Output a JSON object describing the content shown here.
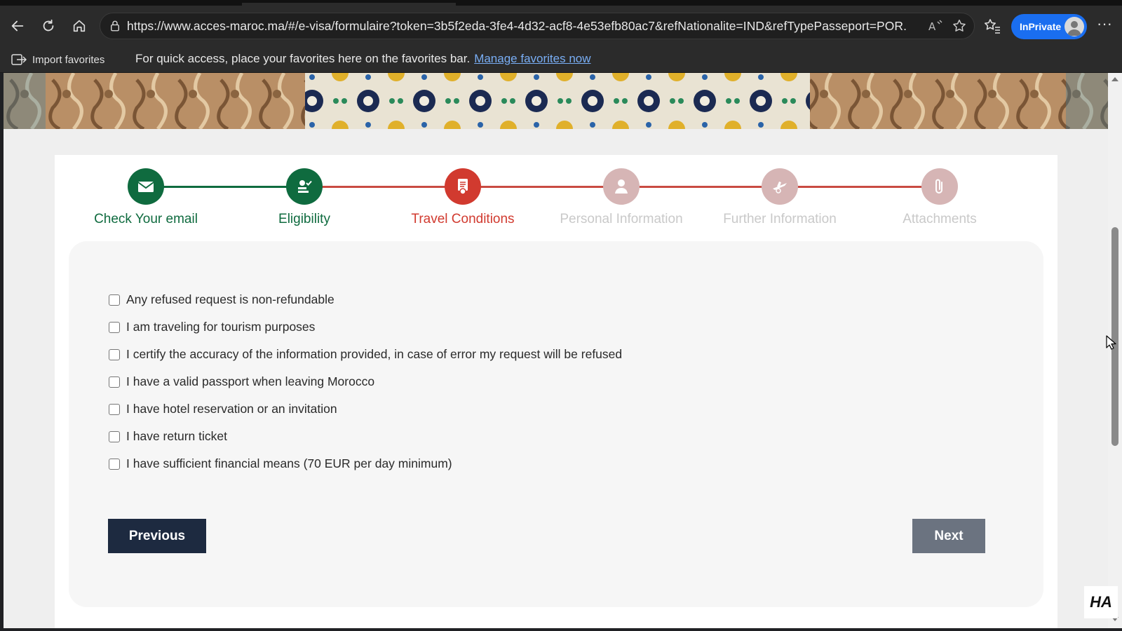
{
  "browser": {
    "url": "https://www.acces-maroc.ma/#/e-visa/formulaire?token=3b5f2eda-3fe4-4d32-acf8-4e53efb80ac7&refNationalite=IND&refTypePasseport=POR...",
    "profile_label": "InPrivate",
    "favorites_bar": {
      "import_label": "Import favorites",
      "message": "For quick access, place your favorites here on the favorites bar.",
      "manage_link": "Manage favorites now"
    }
  },
  "stepper": {
    "steps": [
      {
        "label": "Check Your email",
        "status": "done",
        "icon": "envelope-icon"
      },
      {
        "label": "Eligibility",
        "status": "done",
        "icon": "person-check-icon"
      },
      {
        "label": "Travel Conditions",
        "status": "active",
        "icon": "document-badge-icon"
      },
      {
        "label": "Personal Information",
        "status": "pending",
        "icon": "person-icon"
      },
      {
        "label": "Further Information",
        "status": "pending",
        "icon": "plane-icon"
      },
      {
        "label": "Attachments",
        "status": "pending",
        "icon": "paperclip-icon"
      }
    ],
    "colors": {
      "done": "#0f6b3f",
      "active": "#d13a2f",
      "pending": "#d6b5b5",
      "pending_text": "#c9c9c9"
    }
  },
  "conditions": [
    {
      "label": "Any refused request is non-refundable",
      "checked": false
    },
    {
      "label": "I am traveling for tourism purposes",
      "checked": false
    },
    {
      "label": "I certify the accuracy of the information provided, in case of error my request will be refused",
      "checked": false
    },
    {
      "label": "I have a valid passport when leaving Morocco",
      "checked": false
    },
    {
      "label": "I have hotel reservation or an invitation",
      "checked": false
    },
    {
      "label": "I have return ticket",
      "checked": false
    },
    {
      "label": "I have sufficient financial means (70 EUR per day minimum)",
      "checked": false
    }
  ],
  "buttons": {
    "previous": "Previous",
    "next": "Next"
  },
  "watermark": "HA"
}
